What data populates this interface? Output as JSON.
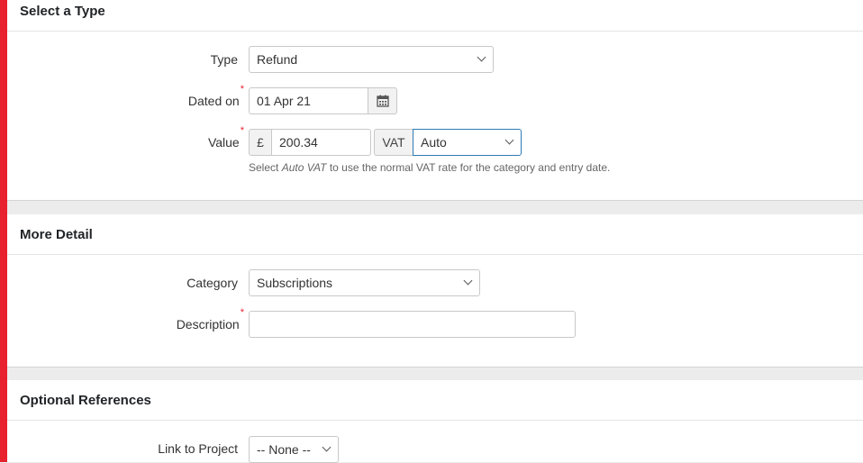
{
  "sections": {
    "type": {
      "title": "Select a Type",
      "type_label": "Type",
      "type_value": "Refund",
      "dated_label": "Dated on",
      "dated_value": "01 Apr 21",
      "value_label": "Value",
      "currency_symbol": "£",
      "amount_value": "200.34",
      "vat_label": "VAT",
      "vat_value": "Auto",
      "help_prefix": "Select ",
      "help_emphasis": "Auto VAT",
      "help_suffix": " to use the normal VAT rate for the category and entry date.",
      "required_mark": "*"
    },
    "detail": {
      "title": "More Detail",
      "category_label": "Category",
      "category_value": "Subscriptions",
      "description_label": "Description",
      "description_value": ""
    },
    "refs": {
      "title": "Optional References",
      "project_label": "Link to Project",
      "project_value": "-- None --"
    }
  },
  "colors": {
    "accent_bar": "#e8212f",
    "required": "#e8212f",
    "focus_border": "#2d7bb6"
  },
  "icons": [
    "calendar-icon",
    "chevron-down-icon"
  ]
}
